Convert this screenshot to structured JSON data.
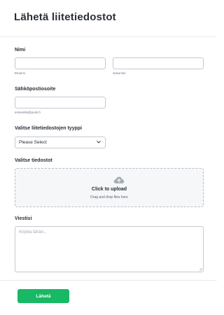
{
  "form": {
    "title": "Lähetä liitetiedostot"
  },
  "name_field": {
    "label": "Nimi",
    "first_name": {
      "value": "",
      "sublabel": "Etunimi"
    },
    "last_name": {
      "value": "",
      "sublabel": "Sukunimi"
    }
  },
  "email_field": {
    "label": "Sähköpostiosoite",
    "value": "",
    "sublabel": "esimerkki@posti.fi"
  },
  "type_field": {
    "label": "Valitse liitetiedostojen tyyppi",
    "selected": "Please Select",
    "icon": "chevron-down-icon"
  },
  "upload_field": {
    "label": "Valitse tiedostot",
    "main_text": "Click to upload",
    "sub_text": "Drag and drop files here",
    "icon": "cloud-upload-icon"
  },
  "message_field": {
    "label": "Viestisi",
    "placeholder": "Kirjoita tähän...",
    "value": ""
  },
  "submit": {
    "label": "Lähetä"
  },
  "colors": {
    "accent": "#19b865",
    "border": "#c4c8cf",
    "text": "#2b2f38"
  }
}
